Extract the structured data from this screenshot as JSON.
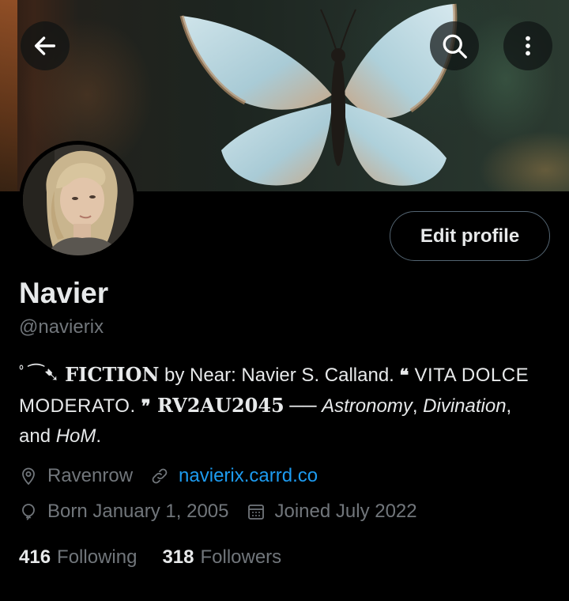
{
  "header": {
    "back_icon": "arrow-left-icon",
    "search_icon": "search-icon",
    "more_icon": "more-vertical-icon"
  },
  "profile": {
    "display_name": "Navier",
    "handle": "@navierix",
    "edit_label": "Edit profile",
    "bio": {
      "deco": "ﾟ⁀➷",
      "fiction": "FICTION",
      "by_near": " by Near: Navier S. Calland. ",
      "open_quote": "❝",
      "vita": " VITA DOLCE MODERATO. ",
      "close_quote": "❞",
      "rv": " RV2AU2045",
      "dash": " ── ",
      "astronomy": "Astronomy",
      "comma1": ", ",
      "divination": "Divination",
      "and": ", and ",
      "hom": "HoM",
      "period": "."
    },
    "location": "Ravenrow",
    "website": "navierix.carrd.co",
    "birthday": "Born January 1, 2005",
    "joined": "Joined July 2022",
    "following_count": "416",
    "following_label": "Following",
    "followers_count": "318",
    "followers_label": "Followers"
  },
  "colors": {
    "background": "#000000",
    "text_primary": "#e7e9ea",
    "text_secondary": "#71767b",
    "link": "#1d9bf0",
    "border": "#536471"
  }
}
